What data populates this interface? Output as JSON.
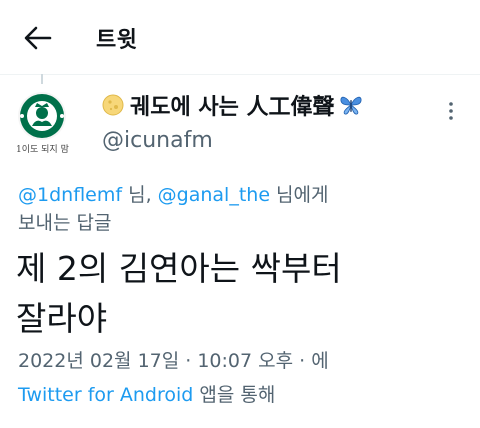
{
  "header": {
    "title": "트윗",
    "back_icon": "arrow-left-icon"
  },
  "author": {
    "display_name": "궤도에 사는 人工偉聲",
    "emoji_before": "moon-emoji-icon",
    "emoji_after": "butterfly-emoji-icon",
    "handle": "@icunafm",
    "avatar_caption": "1이도 되지 맘",
    "more_icon": "more-vertical-icon"
  },
  "reply_context": {
    "mention_1": "@1dnflemf",
    "text_1": " 님, ",
    "mention_2": "@ganal_the",
    "text_2": " 님에게",
    "line_2": "보내는 답글"
  },
  "tweet": {
    "text": "제 2의 김연아는 싹부터\n잘라야"
  },
  "meta": {
    "timestamp": "2022년 02월 17일 · 10:07 오후 · 에",
    "source": "Twitter for Android",
    "source_suffix": " 앱을 통해"
  },
  "colors": {
    "link": "#1d9bf0",
    "secondary_text": "#536471",
    "primary_text": "#0f1419",
    "divider": "#eff3f4"
  }
}
